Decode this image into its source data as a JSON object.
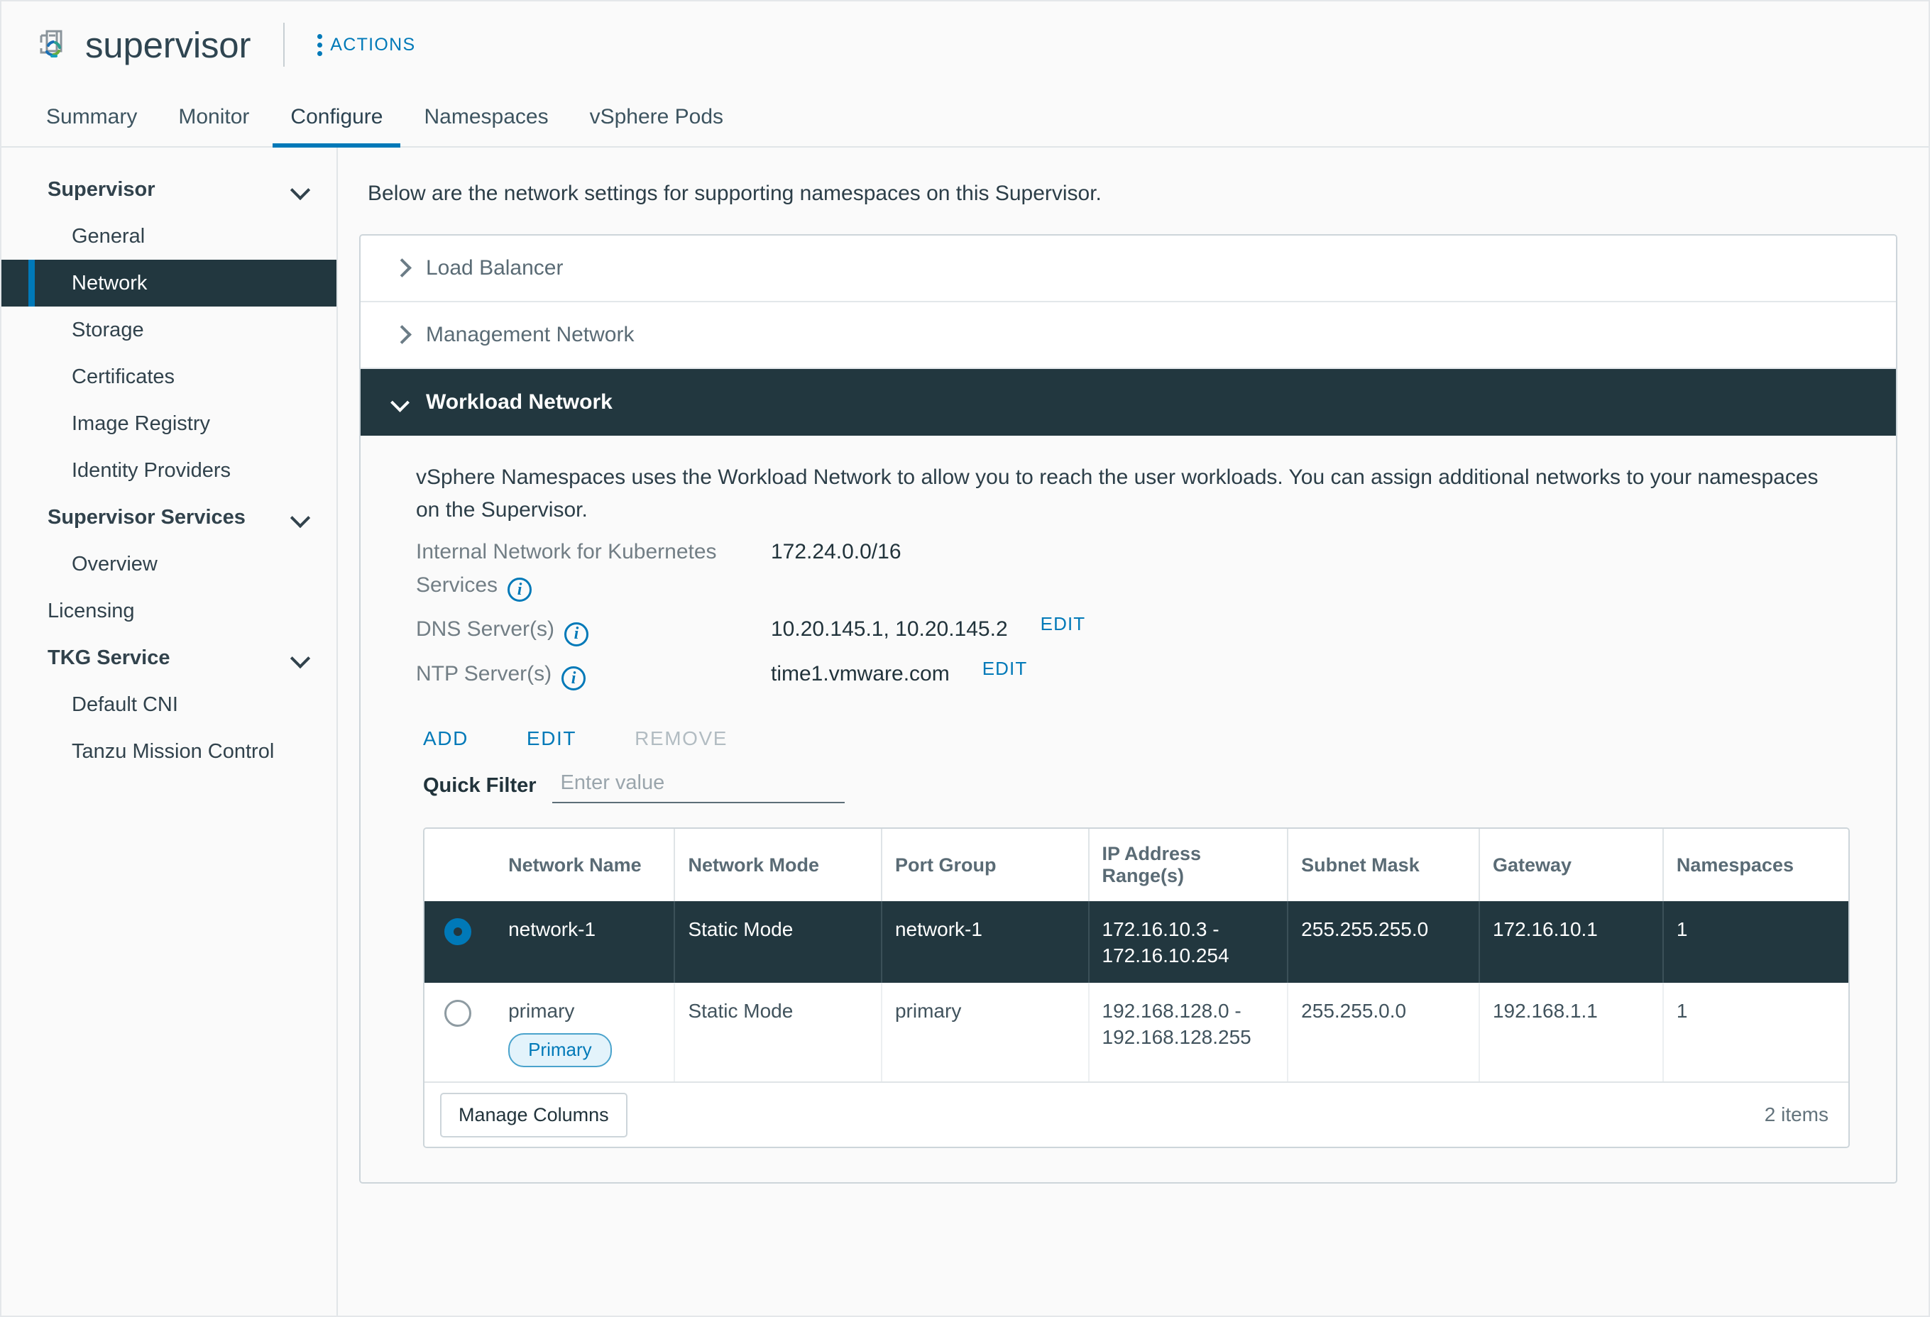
{
  "header": {
    "object_icon": "supervisor-cluster-icon",
    "title": "supervisor",
    "actions_label": "ACTIONS"
  },
  "tabs": [
    {
      "label": "Summary",
      "active": false
    },
    {
      "label": "Monitor",
      "active": false
    },
    {
      "label": "Configure",
      "active": true
    },
    {
      "label": "Namespaces",
      "active": false
    },
    {
      "label": "vSphere Pods",
      "active": false
    }
  ],
  "sidebar": {
    "groups": [
      {
        "label": "Supervisor",
        "chevron": "chevron-down-icon",
        "items": [
          {
            "label": "General",
            "selected": false
          },
          {
            "label": "Network",
            "selected": true
          },
          {
            "label": "Storage",
            "selected": false
          },
          {
            "label": "Certificates",
            "selected": false
          },
          {
            "label": "Image Registry",
            "selected": false
          },
          {
            "label": "Identity Providers",
            "selected": false
          }
        ]
      },
      {
        "label": "Supervisor Services",
        "chevron": "chevron-down-icon",
        "items": [
          {
            "label": "Overview",
            "selected": false
          }
        ]
      }
    ],
    "standalone_items": [
      {
        "label": "Licensing",
        "selected": false
      }
    ],
    "tkg_group": {
      "label": "TKG Service",
      "chevron": "chevron-down-icon",
      "items": [
        {
          "label": "Default CNI",
          "selected": false
        },
        {
          "label": "Tanzu Mission Control",
          "selected": false
        }
      ]
    }
  },
  "main": {
    "intro": "Below are the network settings for supporting namespaces on this Supervisor.",
    "accordions": [
      {
        "label": "Load Balancer",
        "open": false
      },
      {
        "label": "Management Network",
        "open": false
      },
      {
        "label": "Workload Network",
        "open": true
      }
    ],
    "workload": {
      "description": "vSphere Namespaces uses the Workload Network to allow you to reach the user workloads. You can assign additional networks to your namespaces on the Supervisor.",
      "fields": [
        {
          "label": "Internal Network for Kubernetes Services",
          "info": "info-icon",
          "value": "172.24.0.0/16",
          "edit": null
        },
        {
          "label": "DNS Server(s)",
          "info": "info-icon",
          "value": "10.20.145.1, 10.20.145.2",
          "edit": "EDIT"
        },
        {
          "label": "NTP Server(s)",
          "info": "info-icon",
          "value": "time1.vmware.com",
          "edit": "EDIT"
        }
      ],
      "toolbar": [
        {
          "label": "ADD",
          "disabled": false
        },
        {
          "label": "EDIT",
          "disabled": false
        },
        {
          "label": "REMOVE",
          "disabled": true
        }
      ],
      "filter": {
        "label": "Quick Filter",
        "value": "",
        "placeholder": "Enter value"
      },
      "table": {
        "columns": [
          "Network Name",
          "Network Mode",
          "Port Group",
          "IP Address Range(s)",
          "Subnet Mask",
          "Gateway",
          "Namespaces"
        ],
        "rows": [
          {
            "selected": true,
            "network_name": "network-1",
            "badge": null,
            "network_mode": "Static Mode",
            "port_group": "network-1",
            "ip_range": "172.16.10.3 - 172.16.10.254",
            "subnet_mask": "255.255.255.0",
            "gateway": "172.16.10.1",
            "namespaces": "1"
          },
          {
            "selected": false,
            "network_name": "primary",
            "badge": "Primary",
            "network_mode": "Static Mode",
            "port_group": "primary",
            "ip_range": "192.168.128.0 - 192.168.128.255",
            "subnet_mask": "255.255.0.0",
            "gateway": "192.168.1.1",
            "namespaces": "1"
          }
        ],
        "manage_columns_label": "Manage Columns",
        "items_count": "2 items"
      }
    }
  },
  "colors": {
    "accent": "#0079b8",
    "dark": "#22373f",
    "muted": "#727e85"
  }
}
